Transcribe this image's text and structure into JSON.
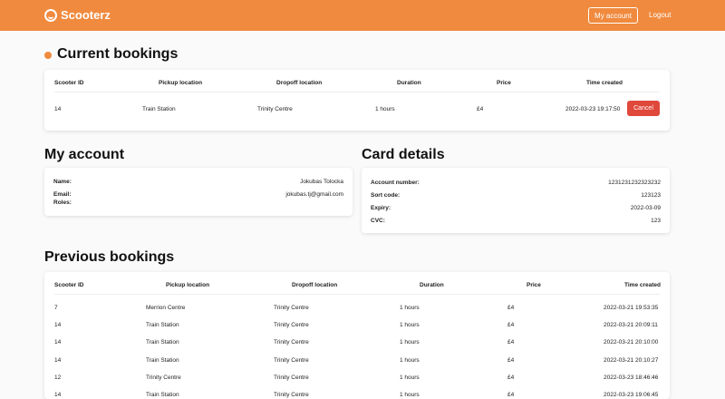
{
  "app": {
    "brand": "Scooterz"
  },
  "nav": {
    "my_account": "My account",
    "logout": "Logout"
  },
  "current": {
    "title": "Current bookings",
    "headers": [
      "Scooter ID",
      "Pickup location",
      "Dropoff location",
      "Duration",
      "Price",
      "Time created"
    ],
    "row": [
      "14",
      "Train Station",
      "Trinity Centre",
      "1 hours",
      "£4",
      "2022-03-23 19:17:50"
    ],
    "cancel_label": "Cancel"
  },
  "account": {
    "title": "My account",
    "name_label": "Name:",
    "name": "Jokubas Tolocka",
    "email_label": "Email:",
    "email": "jokubas.tj@gmail.com",
    "roles_label": "Roles:"
  },
  "card": {
    "title": "Card details",
    "account_label": "Account number:",
    "account": "1231231232323232",
    "sort_label": "Sort code:",
    "sort": "123123",
    "expiry_label": "Expiry:",
    "expiry": "2022-03-09",
    "cvc_label": "CVC:",
    "cvc": "123"
  },
  "previous": {
    "title": "Previous bookings",
    "headers": [
      "Scooter ID",
      "Pickup location",
      "Dropoff location",
      "Duration",
      "Price",
      "Time created"
    ],
    "rows": [
      [
        "7",
        "Merrion Centre",
        "Trinity Centre",
        "1 hours",
        "£4",
        "2022-03-21 19:53:35"
      ],
      [
        "14",
        "Train Station",
        "Trinity Centre",
        "1 hours",
        "£4",
        "2022-03-21 20:09:11"
      ],
      [
        "14",
        "Train Station",
        "Trinity Centre",
        "1 hours",
        "£4",
        "2022-03-21 20:10:00"
      ],
      [
        "14",
        "Train Station",
        "Trinity Centre",
        "1 hours",
        "£4",
        "2022-03-21 20:10:27"
      ],
      [
        "12",
        "Trinity Centre",
        "Trinity Centre",
        "1 hours",
        "£4",
        "2022-03-23 18:46:46"
      ],
      [
        "14",
        "Train Station",
        "Trinity Centre",
        "1 hours",
        "£4",
        "2022-03-23 19:06:45"
      ]
    ]
  },
  "colors": {
    "brand": "#f08a3e",
    "danger": "#e0483b"
  }
}
